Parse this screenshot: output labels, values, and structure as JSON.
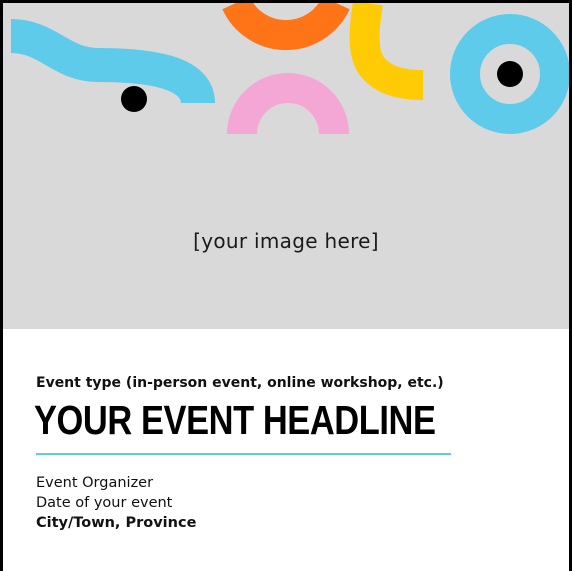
{
  "hero": {
    "placeholder": "[your image here]",
    "colors": {
      "background": "#d9d9d9",
      "blue": "#5ecbea",
      "orange": "#ff7417",
      "yellow": "#ffcb05",
      "pink": "#f4a7d5",
      "dot": "#000000"
    }
  },
  "event": {
    "type": "Event type (in-person event, online workshop, etc.)",
    "headline": "YOUR EVENT HEADLINE",
    "organizer": "Event Organizer",
    "date": "Date of your event",
    "location": "City/Town, Province"
  },
  "accent_color": "#5ecbea"
}
